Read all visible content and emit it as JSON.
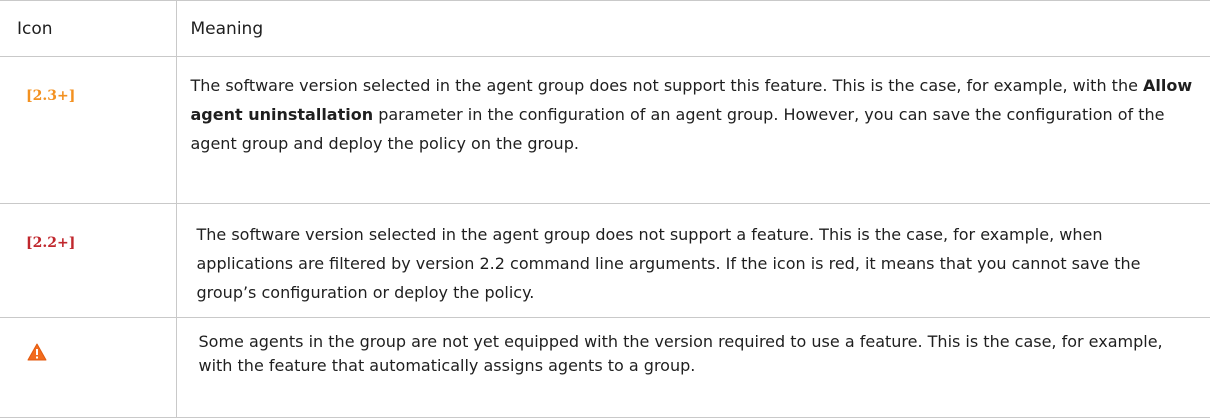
{
  "table": {
    "headers": {
      "icon": "Icon",
      "meaning": "Meaning"
    },
    "rows": [
      {
        "icon_text": "[2.3+]",
        "icon_color": "#f39120",
        "meaning_before": "The software version selected in the agent group does not support this feature. This is the case, for example, with the ",
        "meaning_bold": "Allow agent uninstallation",
        "meaning_after": " parameter in the configuration of an agent group. However, you can save the configuration of the agent group and deploy the policy on the group."
      },
      {
        "icon_text": "[2.2+]",
        "icon_color": "#c0272d",
        "meaning": "The software version selected in the agent group does not support a feature. This is the case, for example, when applications are filtered by version 2.2 command line arguments. If the icon is red, it means that you cannot save the group’s configuration or deploy the policy."
      },
      {
        "icon_name": "warning-triangle-icon",
        "icon_color": "#f26b1d",
        "meaning": "Some agents in the group are not yet equipped with the version required to use a feature. This is the case, for example, with the feature that automatically assigns agents to a group."
      }
    ]
  }
}
